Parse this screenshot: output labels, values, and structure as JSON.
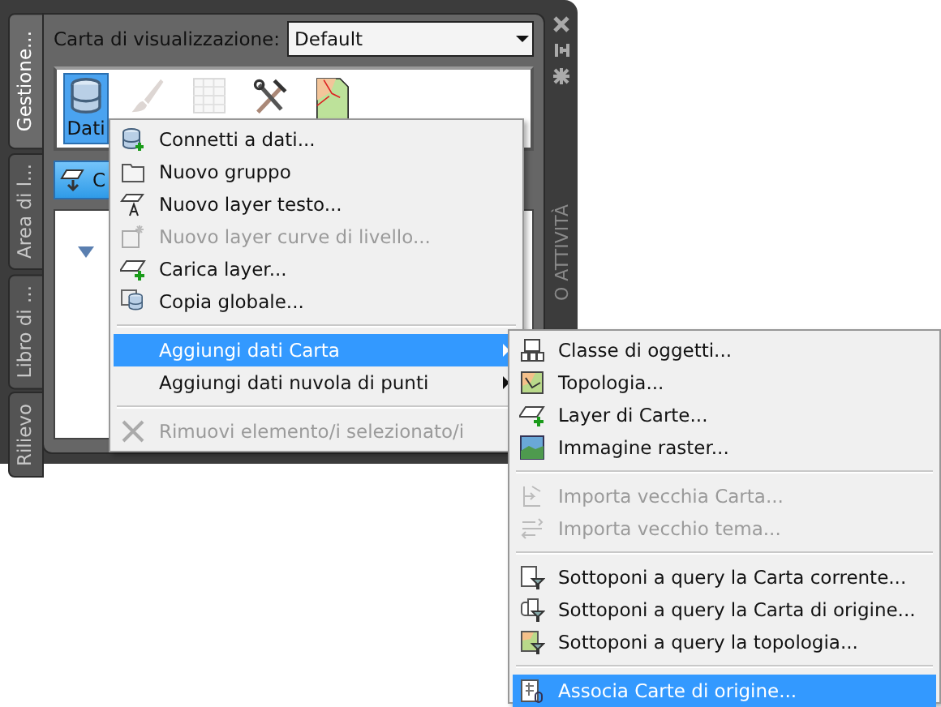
{
  "side_tabs": [
    {
      "label": "Gestione...",
      "selected": true
    },
    {
      "label": "Area di l...",
      "selected": false
    },
    {
      "label": "Libro di ...",
      "selected": false
    },
    {
      "label": "Rilievo",
      "selected": false
    }
  ],
  "display_map": {
    "label": "Carta di visualizzazione:",
    "value": "Default"
  },
  "tools": [
    {
      "label": "Dati",
      "selected": true,
      "disabled": false
    },
    {
      "selected": false,
      "disabled": true
    },
    {
      "selected": false,
      "disabled": true
    },
    {
      "selected": false,
      "disabled": false
    },
    {
      "selected": false,
      "disabled": false
    }
  ],
  "action_button": {
    "label": "C"
  },
  "palette_title": "O ATTIVITÀ",
  "context_menu": {
    "sections": [
      {
        "items": [
          {
            "label": "Connetti a dati...",
            "disabled": false,
            "selected": false,
            "submenu": false
          },
          {
            "label": "Nuovo gruppo",
            "disabled": false,
            "selected": false,
            "submenu": false
          },
          {
            "label": "Nuovo layer testo...",
            "disabled": false,
            "selected": false,
            "submenu": false
          },
          {
            "label": "Nuovo layer curve di livello...",
            "disabled": true,
            "selected": false,
            "submenu": false
          },
          {
            "label": "Carica layer...",
            "disabled": false,
            "selected": false,
            "submenu": false
          },
          {
            "label": "Copia globale...",
            "disabled": false,
            "selected": false,
            "submenu": false
          }
        ]
      },
      {
        "items": [
          {
            "label": "Aggiungi dati Carta",
            "disabled": false,
            "selected": true,
            "submenu": true
          },
          {
            "label": "Aggiungi dati nuvola di punti",
            "disabled": false,
            "selected": false,
            "submenu": true
          }
        ]
      },
      {
        "items": [
          {
            "label": "Rimuovi elemento/i selezionato/i",
            "disabled": true,
            "selected": false,
            "submenu": false
          }
        ]
      }
    ]
  },
  "submenu": {
    "sections": [
      {
        "items": [
          {
            "label": "Classe di oggetti...",
            "disabled": false,
            "selected": false
          },
          {
            "label": "Topologia...",
            "disabled": false,
            "selected": false
          },
          {
            "label": "Layer di Carte...",
            "disabled": false,
            "selected": false
          },
          {
            "label": "Immagine raster...",
            "disabled": false,
            "selected": false
          }
        ]
      },
      {
        "items": [
          {
            "label": "Importa vecchia Carta...",
            "disabled": true,
            "selected": false
          },
          {
            "label": "Importa vecchio tema...",
            "disabled": true,
            "selected": false
          }
        ]
      },
      {
        "items": [
          {
            "label": "Sottoponi a query la Carta corrente...",
            "disabled": false,
            "selected": false
          },
          {
            "label": "Sottoponi a query la Carta di origine...",
            "disabled": false,
            "selected": false
          },
          {
            "label": "Sottoponi a query la topologia...",
            "disabled": false,
            "selected": false
          }
        ]
      },
      {
        "items": [
          {
            "label": "Associa Carte di origine...",
            "disabled": false,
            "selected": true
          }
        ]
      }
    ]
  }
}
